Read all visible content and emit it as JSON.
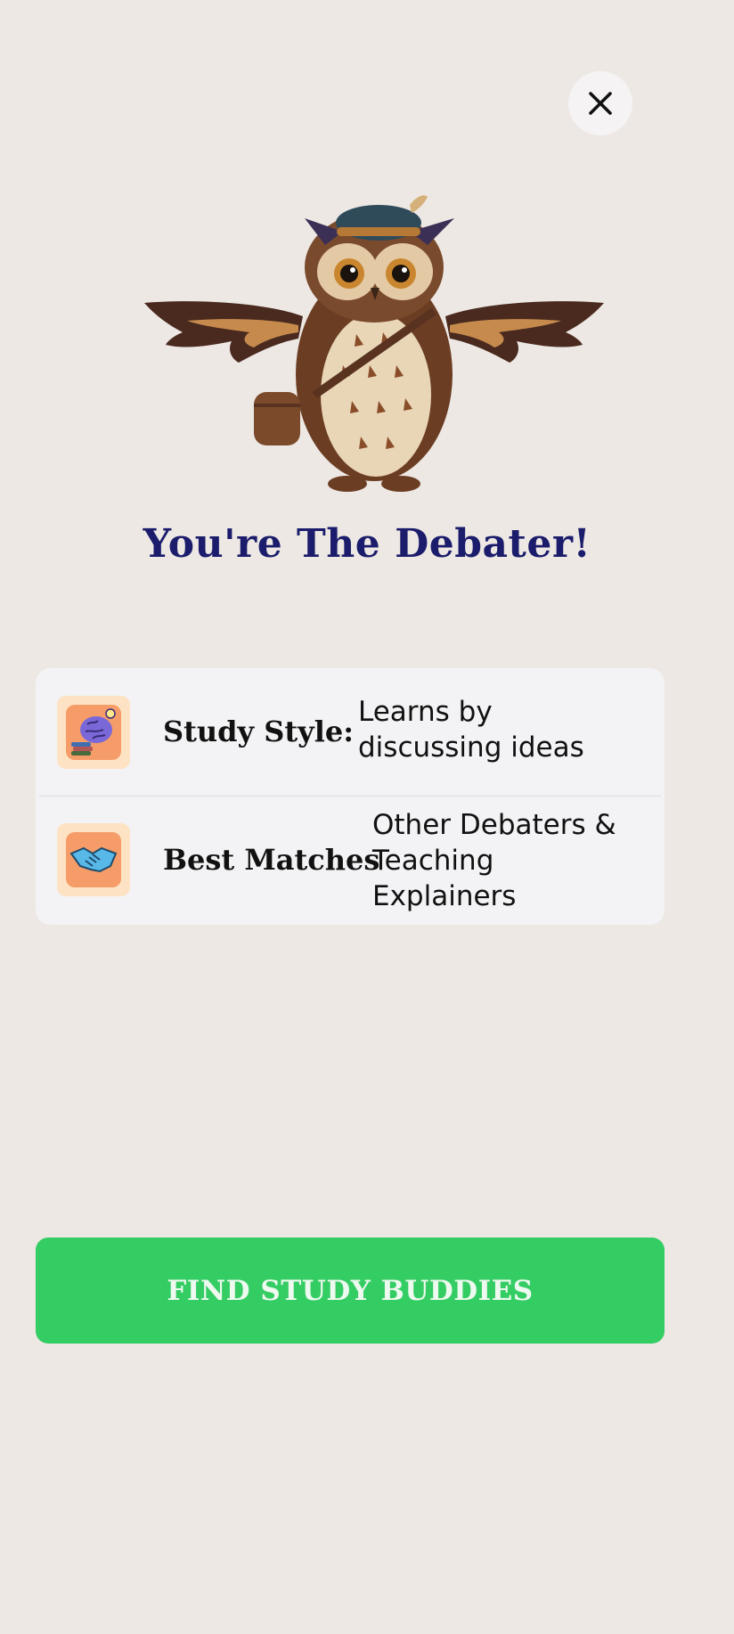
{
  "result": {
    "title": "You're The Debater!"
  },
  "profile": {
    "study_style": {
      "label": "Study Style:",
      "value": "Learns by discussing ideas",
      "icon": "brain-books-icon"
    },
    "best_matches": {
      "label": "Best Matches",
      "value": "Other Debaters & Teaching Explainers",
      "icon": "handshake-icon"
    }
  },
  "actions": {
    "close_icon": "close-icon",
    "cta_label": "FIND STUDY BUDDIES"
  },
  "colors": {
    "background": "#ede8e4",
    "title": "#1b1c6b",
    "cta": "#34cd64",
    "card": "#f3f2f4"
  },
  "mascot": "owl-mascot"
}
